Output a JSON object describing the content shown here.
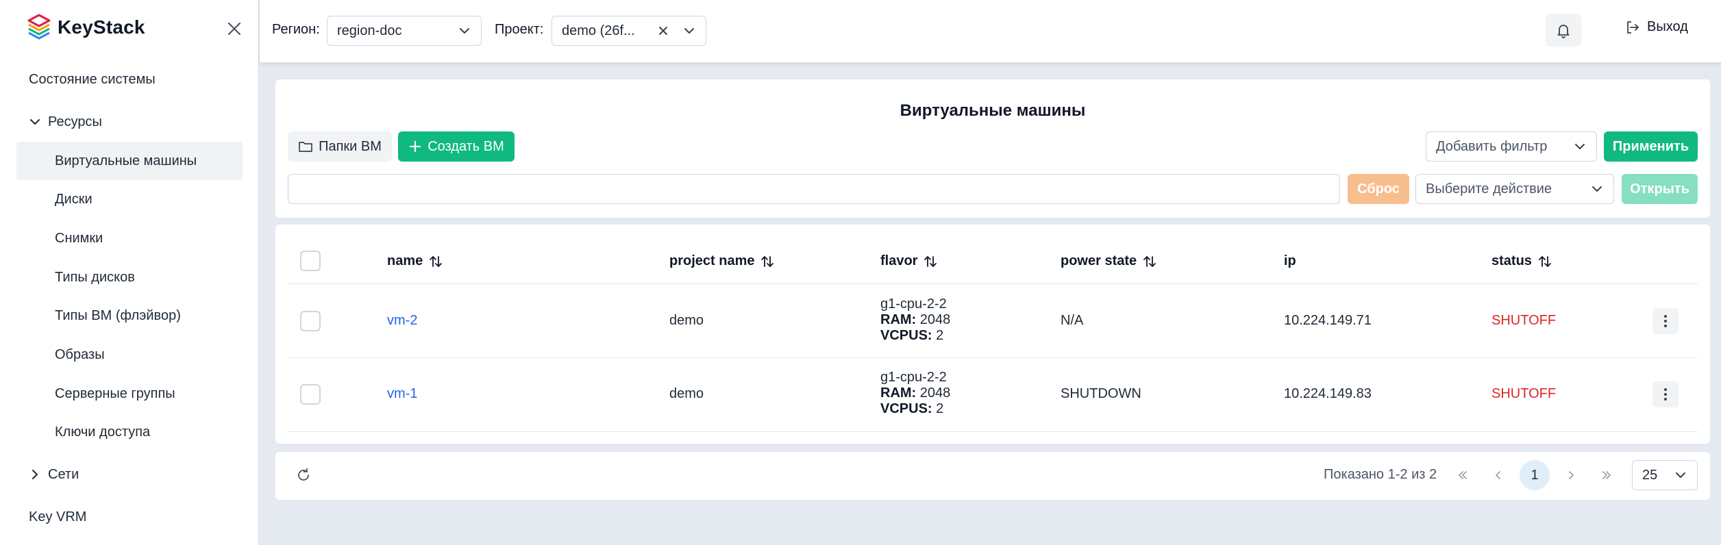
{
  "brand": {
    "name": "KeyStack"
  },
  "sidebar": {
    "items": [
      {
        "label": "Состояние системы",
        "type": "top"
      },
      {
        "label": "Ресурсы",
        "type": "group",
        "expanded": true
      },
      {
        "label": "Виртуальные машины",
        "type": "sub",
        "active": true
      },
      {
        "label": "Диски",
        "type": "sub"
      },
      {
        "label": "Снимки",
        "type": "sub"
      },
      {
        "label": "Типы дисков",
        "type": "sub"
      },
      {
        "label": "Типы ВМ (флэйвор)",
        "type": "sub"
      },
      {
        "label": "Образы",
        "type": "sub"
      },
      {
        "label": "Серверные группы",
        "type": "sub"
      },
      {
        "label": "Ключи доступа",
        "type": "sub"
      },
      {
        "label": "Сети",
        "type": "group",
        "expanded": false
      },
      {
        "label": "Key VRM",
        "type": "top"
      }
    ]
  },
  "header": {
    "region_label": "Регион:",
    "region_value": "region-doc",
    "project_label": "Проект:",
    "project_value": "demo (26f...",
    "logout_label": "Выход"
  },
  "toolbar": {
    "title": "Виртуальные машины",
    "folders_label": "Папки ВМ",
    "create_label": "Создать ВМ",
    "filter_placeholder": "Добавить фильтр",
    "apply_label": "Применить",
    "reset_label": "Сброс",
    "action_placeholder": "Выберите действие",
    "open_label": "Открыть"
  },
  "table": {
    "columns": [
      "name",
      "project name",
      "flavor",
      "power state",
      "ip",
      "status"
    ],
    "rows": [
      {
        "name": "vm-2",
        "project": "demo",
        "flavor_name": "g1-cpu-2-2",
        "ram_label": "RAM:",
        "ram": "2048",
        "vcpus_label": "VCPUS:",
        "vcpus": "2",
        "power_state": "N/A",
        "ip": "10.224.149.71",
        "status": "SHUTOFF"
      },
      {
        "name": "vm-1",
        "project": "demo",
        "flavor_name": "g1-cpu-2-2",
        "ram_label": "RAM:",
        "ram": "2048",
        "vcpus_label": "VCPUS:",
        "vcpus": "2",
        "power_state": "SHUTDOWN",
        "ip": "10.224.149.83",
        "status": "SHUTOFF"
      }
    ]
  },
  "pagination": {
    "summary": "Показано 1-2 из 2",
    "current_page": "1",
    "page_size": "25"
  },
  "colors": {
    "accent_green": "#10b981",
    "link_blue": "#2563eb",
    "status_red": "#dc2626",
    "reset_orange": "#f8bf8e"
  }
}
